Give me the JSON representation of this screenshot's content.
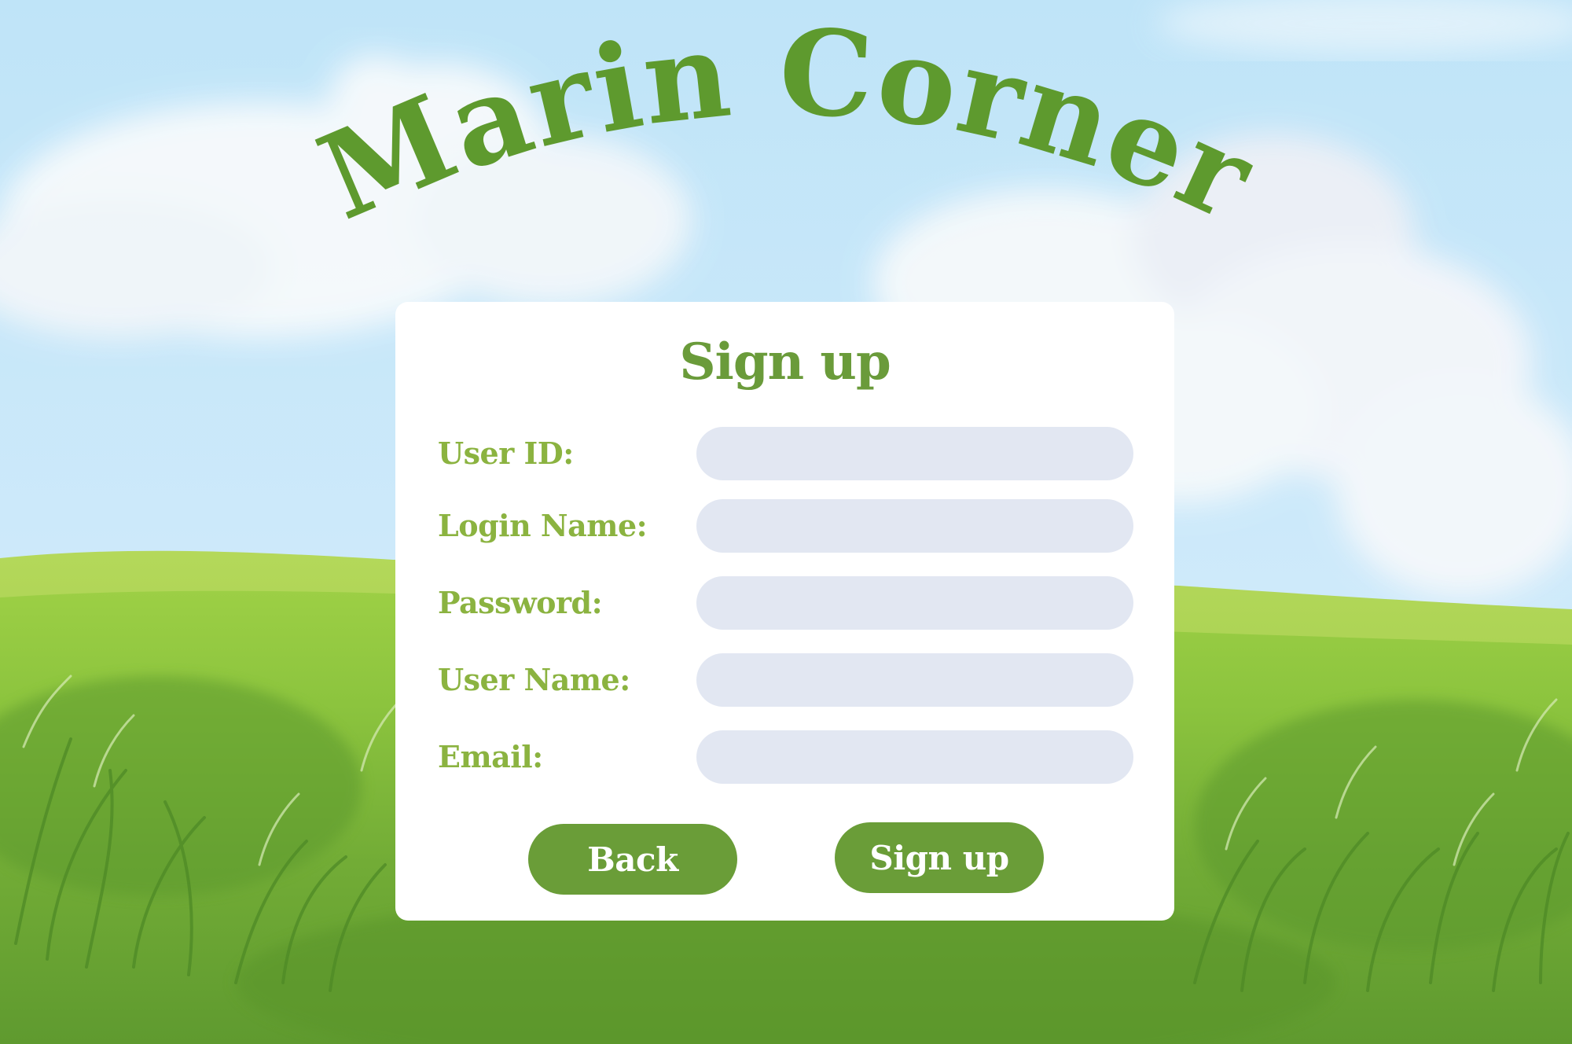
{
  "brand": {
    "title": "Marin Corner",
    "color": "#5e9a2e"
  },
  "form": {
    "title": "Sign up",
    "fields": [
      {
        "label": "User ID:",
        "value": "",
        "placeholder": ""
      },
      {
        "label": "Login Name:",
        "value": "",
        "placeholder": ""
      },
      {
        "label": "Password:",
        "value": "",
        "placeholder": ""
      },
      {
        "label": "User Name:",
        "value": "",
        "placeholder": ""
      },
      {
        "label": "Email:",
        "value": "",
        "placeholder": ""
      }
    ],
    "back_label": "Back",
    "submit_label": "Sign up"
  },
  "colors": {
    "title_green": "#6a9b3a",
    "label_green": "#8bb340",
    "button_green": "#6a9d38",
    "input_fill": "#e2e7f2",
    "card_bg": "#ffffff"
  }
}
